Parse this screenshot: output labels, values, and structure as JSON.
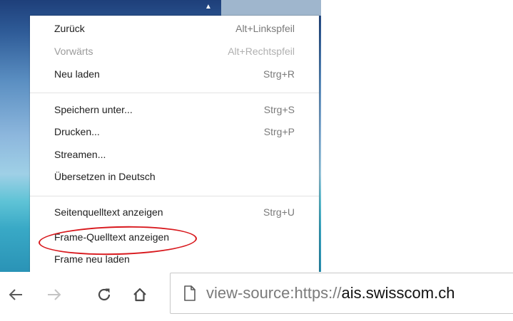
{
  "menu": {
    "items": [
      {
        "label": "Zurück",
        "shortcut": "Alt+Linkspfeil",
        "disabled": false
      },
      {
        "label": "Vorwärts",
        "shortcut": "Alt+Rechtspfeil",
        "disabled": true
      },
      {
        "label": "Neu laden",
        "shortcut": "Strg+R",
        "disabled": false
      },
      {
        "label": "Speichern unter...",
        "shortcut": "Strg+S",
        "disabled": false
      },
      {
        "label": "Drucken...",
        "shortcut": "Strg+P",
        "disabled": false
      },
      {
        "label": "Streamen...",
        "shortcut": "",
        "disabled": false
      },
      {
        "label": "Übersetzen in Deutsch",
        "shortcut": "",
        "disabled": false
      },
      {
        "label": "Seitenquelltext anzeigen",
        "shortcut": "Strg+U",
        "disabled": false
      },
      {
        "label": "Frame-Quelltext anzeigen",
        "shortcut": "",
        "disabled": false,
        "highlighted": true
      },
      {
        "label": "Frame neu laden",
        "shortcut": "",
        "disabled": false
      }
    ],
    "highlight_color": "#d8181d"
  },
  "toolbar": {
    "back_icon": "arrow-left-icon",
    "forward_icon": "arrow-right-icon",
    "reload_icon": "reload-icon",
    "home_icon": "home-icon",
    "page_icon": "page-icon",
    "url_prefix": "view-source:https://",
    "url_host": "ais.swisscom.ch"
  },
  "colors": {
    "menu_text": "#202020",
    "disabled_text": "#9a9a9a",
    "shortcut_text": "#7a7a7a"
  }
}
